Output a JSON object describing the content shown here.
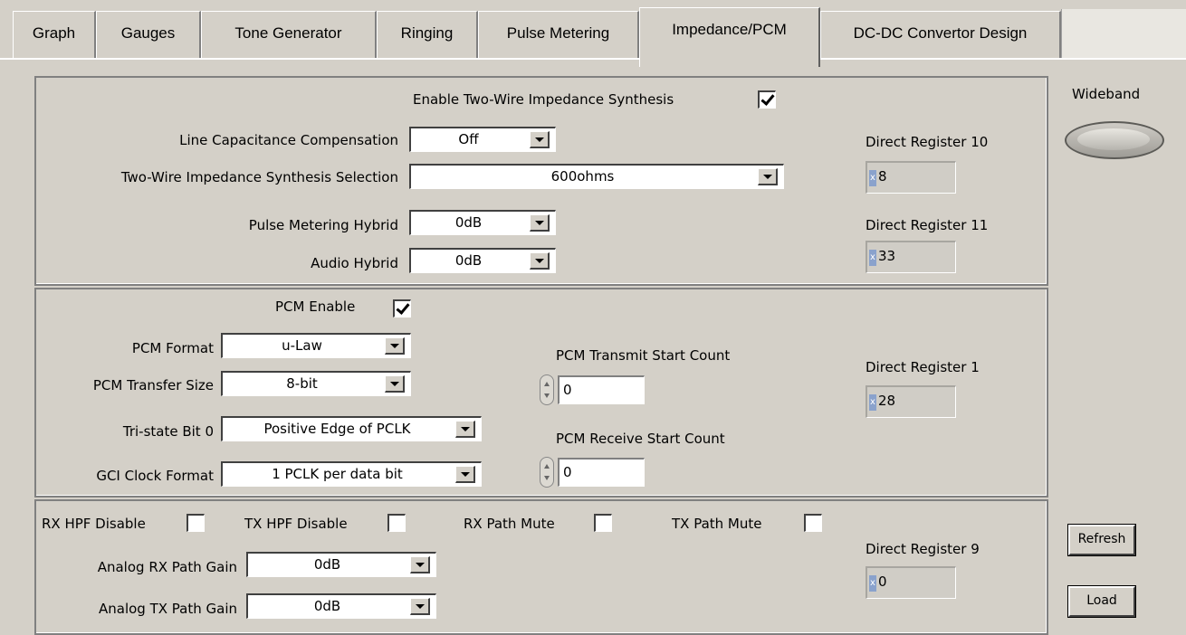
{
  "tabs": [
    "Graph",
    "Gauges",
    "Tone Generator",
    "Ringing",
    "Pulse Metering",
    "Impedance/PCM",
    "DC-DC Convertor Design"
  ],
  "active_tab": "Impedance/PCM",
  "impedance": {
    "enable_label": "Enable Two-Wire Impedance Synthesis",
    "enable_checked": true,
    "line_cap_label": "Line Capacitance Compensation",
    "line_cap_value": "Off",
    "twowire_sel_label": "Two-Wire Impedance Synthesis Selection",
    "twowire_sel_value": "600ohms",
    "pm_hybrid_label": "Pulse Metering Hybrid",
    "pm_hybrid_value": "0dB",
    "audio_hybrid_label": "Audio Hybrid",
    "audio_hybrid_value": "0dB",
    "reg10_label": "Direct Register 10",
    "reg10_value": "8",
    "reg11_label": "Direct Register 11",
    "reg11_value": "33"
  },
  "pcm": {
    "enable_label": "PCM Enable",
    "enable_checked": true,
    "format_label": "PCM Format",
    "format_value": "u-Law",
    "transfer_label": "PCM Transfer Size",
    "transfer_value": "8-bit",
    "tristate_label": "Tri-state Bit 0",
    "tristate_value": "Positive Edge of PCLK",
    "gci_label": "GCI Clock Format",
    "gci_value": "1 PCLK per data bit",
    "tx_start_label": "PCM Transmit Start Count",
    "tx_start_value": "0",
    "rx_start_label": "PCM Receive Start Count",
    "rx_start_value": "0",
    "reg1_label": "Direct Register 1",
    "reg1_value": "28"
  },
  "audio": {
    "rx_hpf_label": "RX HPF Disable",
    "tx_hpf_label": "TX HPF Disable",
    "rx_mute_label": "RX Path Mute",
    "tx_mute_label": "TX Path Mute",
    "rx_gain_label": "Analog RX Path Gain",
    "rx_gain_value": "0dB",
    "tx_gain_label": "Analog TX Path Gain",
    "tx_gain_value": "0dB",
    "reg9_label": "Direct Register 9",
    "reg9_value": "0"
  },
  "side": {
    "wideband_label": "Wideband",
    "refresh_label": "Refresh",
    "load_label": "Load"
  },
  "reg_prefix": "x"
}
